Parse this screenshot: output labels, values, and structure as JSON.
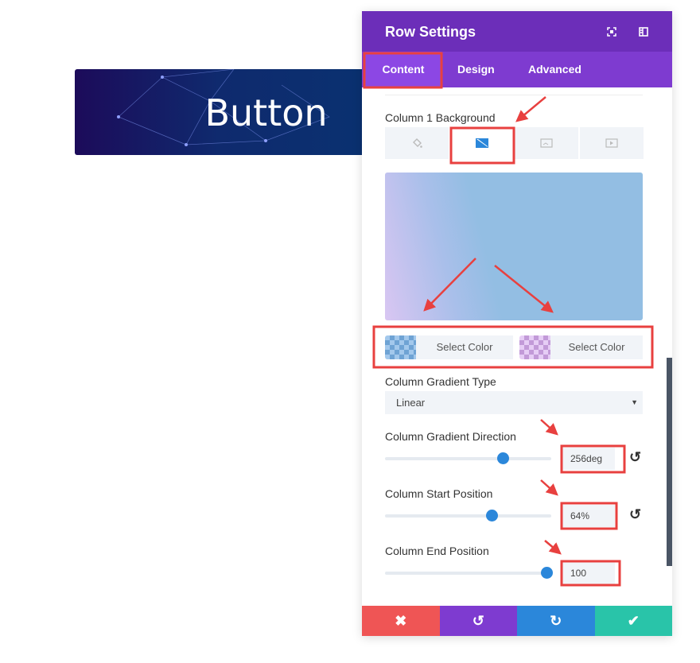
{
  "preview": {
    "button_text": "Button"
  },
  "panel": {
    "title": "Row Settings",
    "tabs": [
      {
        "label": "Content",
        "active": true
      },
      {
        "label": "Design"
      },
      {
        "label": "Advanced"
      }
    ],
    "background": {
      "label": "Column 1 Background",
      "tabs": [
        "color-icon",
        "gradient-icon",
        "image-icon",
        "video-icon"
      ],
      "active_tab": "gradient",
      "gradient_colors": [
        "#c9c0f0",
        "#93bee3"
      ]
    },
    "colors": [
      {
        "label": "Select Color",
        "swatch": "#7fb0dd"
      },
      {
        "label": "Select Color",
        "swatch": "#d9b8ec"
      }
    ],
    "gradient_type": {
      "label": "Column Gradient Type",
      "value": "Linear"
    },
    "direction": {
      "label": "Column Gradient Direction",
      "value": "256deg",
      "fraction": 0.71
    },
    "start": {
      "label": "Column Start Position",
      "value": "64%",
      "fraction": 0.64
    },
    "end": {
      "label": "Column End Position",
      "value": "100",
      "fraction": 0.97
    },
    "footer": {
      "colors": [
        "#ef5555",
        "#7e3bd0",
        "#2b87da",
        "#29c4a9"
      ]
    }
  }
}
